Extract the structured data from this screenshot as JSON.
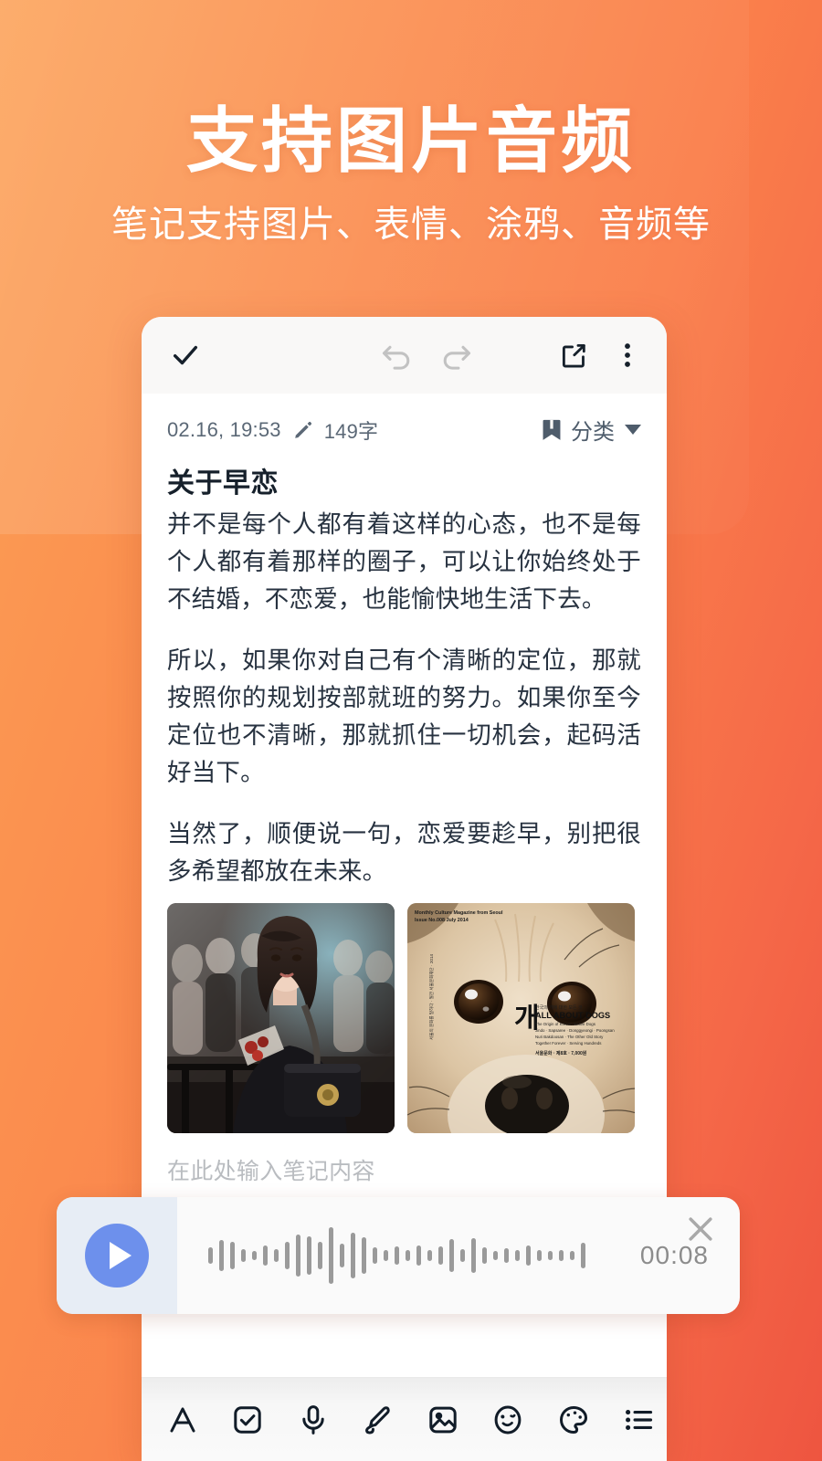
{
  "hero": {
    "title": "支持图片音频",
    "subtitle": "笔记支持图片、表情、涂鸦、音频等"
  },
  "colors": {
    "bg_gradient_start": "#FBA055",
    "bg_gradient_end": "#EE5540",
    "accent_blue": "#6D90EC",
    "audio_left_bg": "#E7EDF5",
    "text_dark": "#16202B",
    "text_body": "#273240",
    "meta_text": "#5B6876",
    "placeholder": "#B9BCC0"
  },
  "topbar": {
    "confirm_label": "confirm",
    "undo_label": "undo",
    "redo_label": "redo",
    "share_label": "share",
    "more_label": "more",
    "icons": [
      "check-icon",
      "undo-icon",
      "redo-icon",
      "share-icon",
      "more-vertical-icon"
    ]
  },
  "meta": {
    "date": "02.16, 19:53",
    "edit_icon": "pencil-icon",
    "word_count": "149字",
    "category_icon": "bookmark-icon",
    "category_label": "分类",
    "caret_icon": "chevron-down-icon"
  },
  "note": {
    "title": "关于早恋",
    "paragraphs": [
      "并不是每个人都有着这样的心态，也不是每个人都有着那样的圈子，可以让你始终处于不结婚，不恋爱，也能愉快地生活下去。",
      "所以，如果你对自己有个清晰的定位，那就按照你的规划按部就班的努力。如果你至今定位也不清晰，那就抓住一切机会，起码活好当下。",
      "当然了，顺便说一句，恋爱要趁早，别把很多希望都放在未来。"
    ],
    "placeholder": "在此处输入笔记内容",
    "images": [
      {
        "name": "photo-woman-night-street",
        "alt": "短发女子夜晚街头侧身照"
      },
      {
        "name": "photo-dog-magazine-cover",
        "alt": "狗狗特写杂志封面 개 ALL ABOUT DOGS"
      }
    ]
  },
  "audio": {
    "play_icon": "play-icon",
    "duration": "00:08",
    "close_icon": "close-icon",
    "waveform": [
      18,
      34,
      30,
      14,
      10,
      22,
      14,
      30,
      46,
      42,
      30,
      62,
      26,
      50,
      40,
      18,
      12,
      20,
      12,
      22,
      12,
      20,
      36,
      14,
      38,
      18,
      10,
      16,
      12,
      22,
      12,
      10,
      12,
      10,
      28
    ]
  },
  "edit_toolbar": {
    "items": [
      {
        "name": "text-format-icon",
        "label": "A"
      },
      {
        "name": "checkbox-icon",
        "label": "待办"
      },
      {
        "name": "microphone-icon",
        "label": "录音"
      },
      {
        "name": "pen-icon",
        "label": "涂鸦"
      },
      {
        "name": "image-icon",
        "label": "图片"
      },
      {
        "name": "emoji-icon",
        "label": "表情"
      },
      {
        "name": "palette-icon",
        "label": "调色"
      },
      {
        "name": "list-icon",
        "label": "列表"
      }
    ]
  }
}
